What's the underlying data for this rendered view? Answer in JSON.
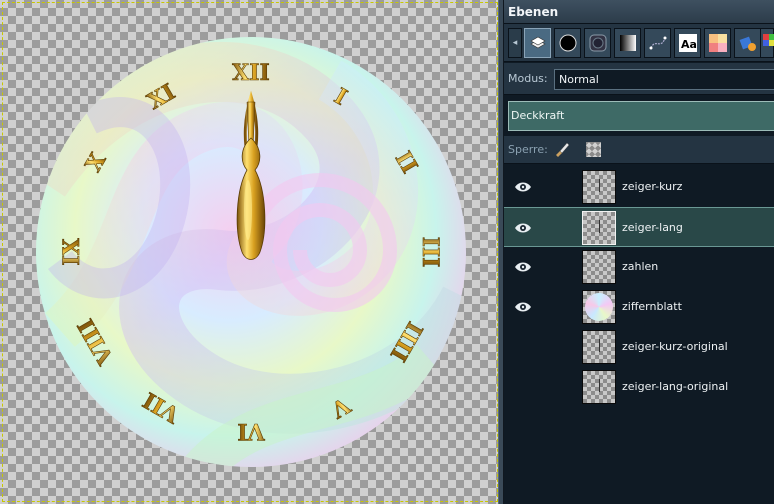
{
  "panel": {
    "title": "Ebenen",
    "tabs": [
      {
        "icon": "layers-icon",
        "active": true
      },
      {
        "icon": "brush-icon"
      },
      {
        "icon": "pattern-icon"
      },
      {
        "icon": "gradient-icon"
      },
      {
        "icon": "paths-icon"
      },
      {
        "icon": "font-icon",
        "text": "Aa"
      },
      {
        "icon": "palette-icon"
      },
      {
        "icon": "tool-presets-icon"
      },
      {
        "icon": "colormap-icon"
      }
    ],
    "mode_label": "Modus:",
    "mode_value": "Normal",
    "opacity_label": "Deckkraft",
    "lock_label": "Sperre:"
  },
  "layers": [
    {
      "name": "zeiger-kurz",
      "visible": true,
      "selected": false,
      "thumb": "mark"
    },
    {
      "name": "zeiger-lang",
      "visible": true,
      "selected": true,
      "thumb": "mark"
    },
    {
      "name": "zahlen",
      "visible": true,
      "selected": false,
      "thumb": "empty"
    },
    {
      "name": "ziffernblatt",
      "visible": true,
      "selected": false,
      "thumb": "dial"
    },
    {
      "name": "zeiger-kurz-original",
      "visible": false,
      "selected": false,
      "thumb": "mark"
    },
    {
      "name": "zeiger-lang-original",
      "visible": false,
      "selected": false,
      "thumb": "mark"
    }
  ],
  "clock": {
    "numerals": [
      "XII",
      "I",
      "II",
      "III",
      "IIII",
      "V",
      "VI",
      "VII",
      "VIII",
      "IX",
      "X",
      "XI"
    ],
    "time": "12:00",
    "colors": {
      "gold": "#d8a020",
      "gold_dark": "#7a5008",
      "gold_light": "#ffe070"
    }
  }
}
